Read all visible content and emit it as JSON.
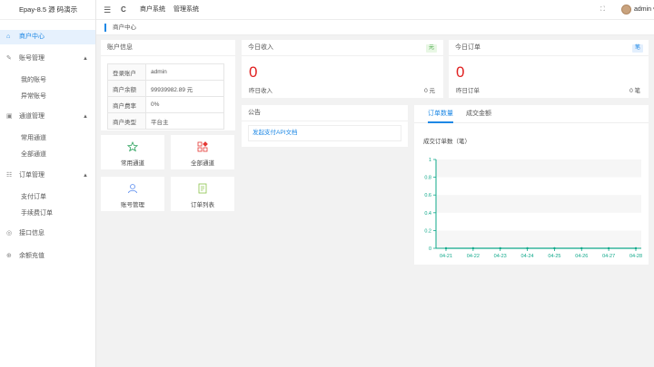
{
  "app": {
    "title": "Epay-8.5 源 码演示"
  },
  "sidebar": {
    "items": [
      {
        "label": "商户中心"
      },
      {
        "label": "账号管理"
      },
      {
        "label": "我的账号"
      },
      {
        "label": "异常账号"
      },
      {
        "label": "通道管理"
      },
      {
        "label": "常用通道"
      },
      {
        "label": "全部通道"
      },
      {
        "label": "订单管理"
      },
      {
        "label": "支付订单"
      },
      {
        "label": "手续费订单"
      },
      {
        "label": "接口信息"
      },
      {
        "label": "余额充值"
      }
    ]
  },
  "topbar": {
    "menu_icon": "☰",
    "refresh_icon": "C",
    "links": [
      "商户系统",
      "管理系统"
    ],
    "fullscreen_icon": "⛶",
    "user": "admin ▾"
  },
  "breadcrumb": "商户中心",
  "account_card": {
    "title": "账户信息",
    "rows": [
      {
        "key": "登录账户",
        "value": "admin"
      },
      {
        "key": "商户余额",
        "value": "99939982.89 元"
      },
      {
        "key": "商户费率",
        "value": "0%"
      },
      {
        "key": "商户类型",
        "value": "平台主"
      }
    ]
  },
  "tiles": [
    {
      "label": "常用通道",
      "icon": "star-icon",
      "color": "#27a05a"
    },
    {
      "label": "全部通道",
      "icon": "grid-icon",
      "color": "#e53935"
    },
    {
      "label": "账号管理",
      "icon": "user-icon",
      "color": "#5b8def"
    },
    {
      "label": "订单列表",
      "icon": "document-icon",
      "color": "#8bc34a"
    }
  ],
  "income_card": {
    "title": "今日收入",
    "badge": "元",
    "value": "0",
    "sub_label": "昨日收入",
    "sub_value": "0 元",
    "badge_bg": "#e8f7e4",
    "badge_color": "#3aa23a"
  },
  "orders_card": {
    "title": "今日订单",
    "badge": "笔",
    "value": "0",
    "sub_label": "昨日订单",
    "sub_value": "0 笔",
    "badge_bg": "#e3effd",
    "badge_color": "#1e88e5"
  },
  "notice_card": {
    "title": "公告",
    "link": "发起支付API文档"
  },
  "chart_card": {
    "tabs": [
      "订单数量",
      "成交金额"
    ]
  },
  "chart_data": {
    "type": "line",
    "title": "成交订单数（笔）",
    "categories": [
      "04-21",
      "04-22",
      "04-23",
      "04-24",
      "04-25",
      "04-26",
      "04-27",
      "04-28"
    ],
    "values": [
      0,
      0,
      0,
      0,
      0,
      0,
      0,
      0
    ],
    "ylim": [
      0,
      1
    ],
    "yticks": [
      "0",
      "0.2",
      "0.4",
      "0.6",
      "0.8",
      "1"
    ],
    "color": "#0fa88a"
  }
}
